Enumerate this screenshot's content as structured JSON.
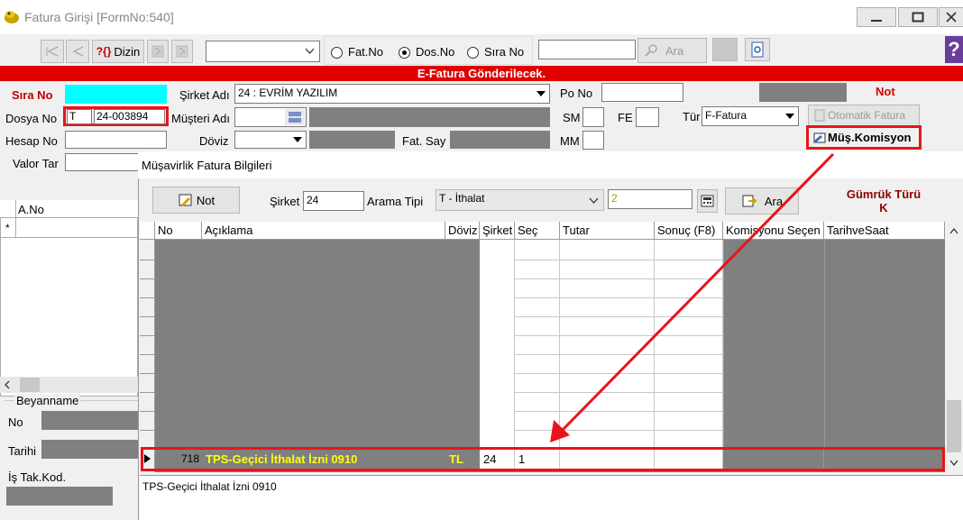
{
  "window": {
    "title": "Fatura Girişi [FormNo:540]"
  },
  "toolbar": {
    "dizin_label": "Dizin",
    "dizin_prefix": "?{}",
    "search_placeholder": "",
    "radio_fatno": "Fat.No",
    "radio_dosno": "Dos.No",
    "radio_sirano": "Sıra No",
    "selected_radio": "Dos.No",
    "ara_label": "Ara"
  },
  "banner": "E-Fatura Gönderilecek.",
  "form": {
    "sira_no_label": "Sıra No",
    "dosya_no_label": "Dosya No",
    "dosya_prefix": "T",
    "dosya_no": "24-003894",
    "hesap_no_label": "Hesap No",
    "valor_label": "Valor Tar",
    "sirket_adi_label": "Şirket Adı",
    "sirket_adi_value": "24 : EVRİM YAZILIM",
    "musteri_adi_label": "Müşteri Adı",
    "doviz_label": "Döviz",
    "fat_say_label": "Fat. Say",
    "po_no_label": "Po No",
    "sm_label": "SM",
    "fe_label": "FE",
    "mm_label": "MM",
    "tur_label": "Tür",
    "tur_value": "F-Fatura",
    "not_status": "Not",
    "otomatik_fatura_label": "Otomatik Fatura",
    "mus_komisyon_label": "Müş.Komisyon"
  },
  "left_panel": {
    "ano_header": "A.No",
    "new_row_marker": "*",
    "beyanname_label": "Beyanname",
    "no_label": "No",
    "tarihi_label": "Tarihi",
    "is_tak_kod_label": "İş Tak.Kod."
  },
  "dialog": {
    "title": "Müşavirlik Fatura Bilgileri",
    "not_button": "Not",
    "sirket_label": "Şirket",
    "sirket_value": "24",
    "arama_tipi_label": "Arama Tipi",
    "arama_tipi_value": "T - İthalat",
    "arama_value": "2",
    "ara_button": "Ara",
    "gumruk_turu_label": "Gümrük Türü",
    "gumruk_turu_value": "K",
    "columns": [
      "No",
      "Açıklama",
      "Döviz",
      "Şirket",
      "Seç",
      "Tutar",
      "Sonuç (F8)",
      "Komisyonu Seçen",
      "TarihveSaat"
    ],
    "selected_row": {
      "no": "718",
      "aciklama": "TPS-Geçici İthalat İzni 0910",
      "doviz": "TL",
      "sirket": "24",
      "sec": "1",
      "tutar": "",
      "sonuc": "",
      "komisyonu_secen": "",
      "tarih_saat": ""
    },
    "memo": "TPS-Geçici İthalat İzni 0910"
  },
  "colors": {
    "banner_red": "#e00000",
    "highlight_red": "#e8141b",
    "cyan_field": "#00ffff",
    "row_text_yellow": "#ffff00",
    "status_red": "#d40000"
  }
}
